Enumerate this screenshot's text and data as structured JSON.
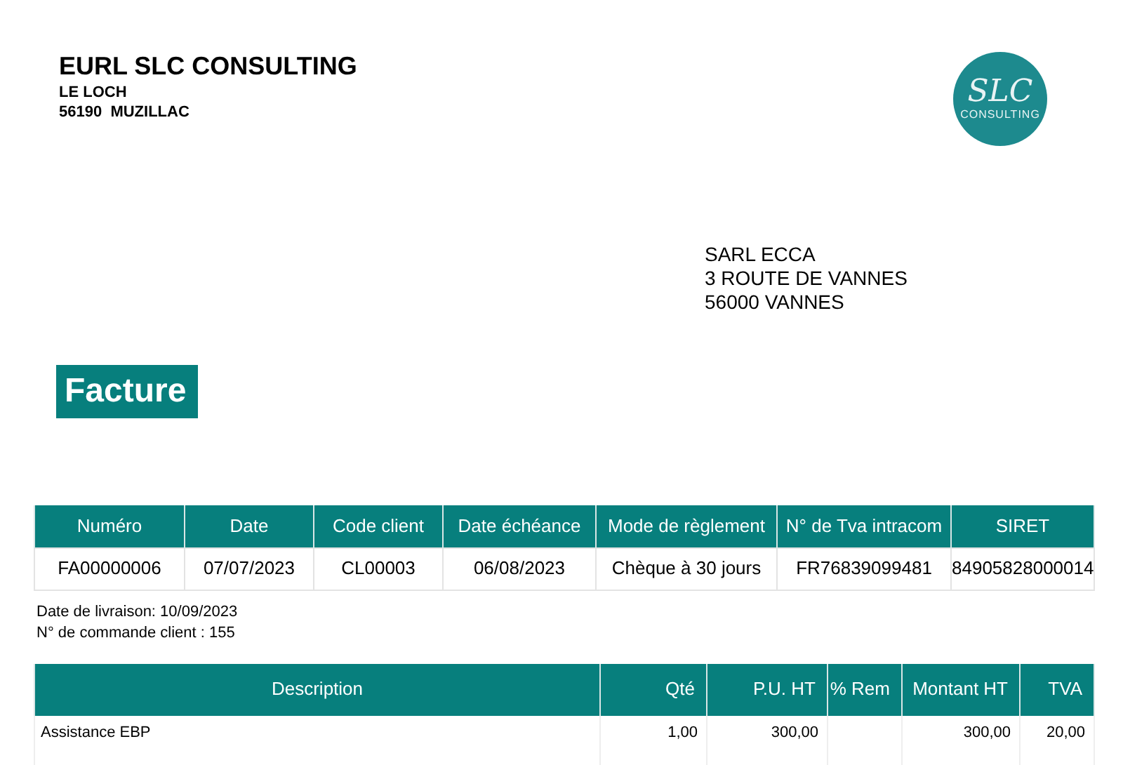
{
  "company": {
    "name": "EURL SLC CONSULTING",
    "address_lines": [
      "LE LOCH",
      "56190  MUZILLAC"
    ]
  },
  "logo": {
    "initials": "SLC",
    "subtitle": "CONSULTING"
  },
  "recipient": {
    "lines": [
      "SARL ECCA",
      "3 ROUTE DE VANNES",
      "56000 VANNES"
    ]
  },
  "document_title": "Facture",
  "info_table": {
    "columns": [
      "Numéro",
      "Date",
      "Code client",
      "Date échéance",
      "Mode de règlement",
      "N° de Tva intracom",
      "SIRET"
    ],
    "rows": [
      [
        "FA00000006",
        "07/07/2023",
        "CL00003",
        "06/08/2023",
        "Chèque à 30 jours",
        "FR76839099481",
        "84905828000014"
      ]
    ]
  },
  "notes": [
    "Date de livraison: 10/09/2023",
    "N° de commande client : 155"
  ],
  "lines_table": {
    "columns": [
      "Description",
      "Qté",
      "P.U. HT",
      "% Rem",
      "Montant HT",
      "TVA"
    ],
    "rows": [
      [
        "Assistance EBP",
        "1,00",
        "300,00",
        "",
        "300,00",
        "20,00"
      ]
    ]
  }
}
